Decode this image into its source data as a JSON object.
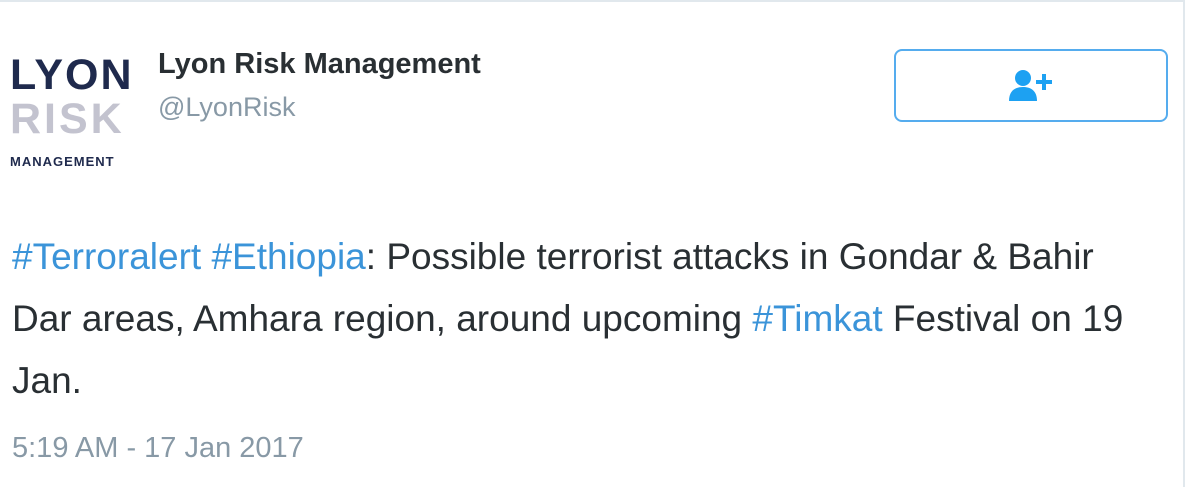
{
  "colors": {
    "hashtag": "#3b94d9",
    "text": "#292f33",
    "muted": "#8899a6",
    "follow_border": "#55acee"
  },
  "logo": {
    "line1": "LYON",
    "line2": "RISK",
    "line3": "MANAGEMENT"
  },
  "account": {
    "name": "Lyon Risk Management",
    "handle": "@LyonRisk"
  },
  "follow_button": {
    "icon": "add-user-icon"
  },
  "tweet": {
    "hashtag1": "#Terroralert",
    "space1": " ",
    "hashtag2": "#Ethiopia",
    "text1": ": Possible terrorist attacks in Gondar & Bahir Dar areas, Amhara region, around upcoming ",
    "hashtag3": "#Timkat",
    "text2": " Festival on 19 Jan."
  },
  "timestamp": "5:19 AM - 17 Jan 2017"
}
